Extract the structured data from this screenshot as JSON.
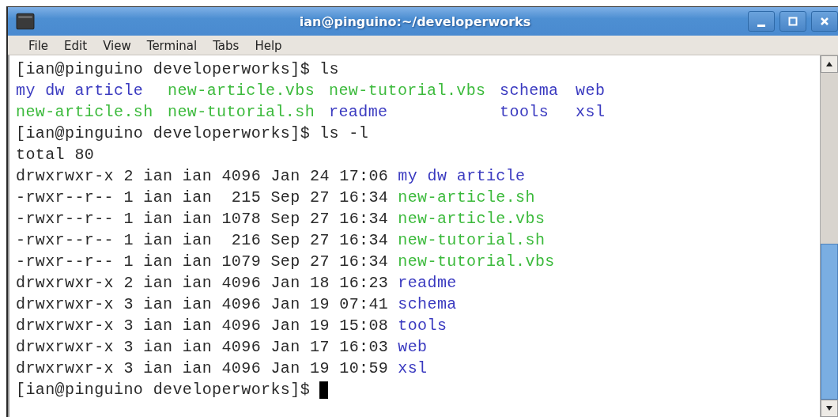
{
  "window": {
    "title": "ian@pinguino:~/developerworks"
  },
  "menu": [
    {
      "label": "File"
    },
    {
      "label": "Edit"
    },
    {
      "label": "View"
    },
    {
      "label": "Terminal"
    },
    {
      "label": "Tabs"
    },
    {
      "label": "Help"
    }
  ],
  "terminal": {
    "lines": [
      {
        "kind": "prompt",
        "prompt": "[ian@pinguino developerworks]$",
        "command": "ls"
      },
      {
        "kind": "grid",
        "items": [
          {
            "name": "my dw article",
            "kind": "dir"
          },
          {
            "name": "new-article.vbs",
            "kind": "exec"
          },
          {
            "name": "new-tutorial.vbs",
            "kind": "exec"
          },
          {
            "name": "schema",
            "kind": "dir"
          },
          {
            "name": "web",
            "kind": "dir"
          }
        ]
      },
      {
        "kind": "grid",
        "items": [
          {
            "name": "new-article.sh",
            "kind": "exec"
          },
          {
            "name": "new-tutorial.sh",
            "kind": "exec"
          },
          {
            "name": "readme",
            "kind": "dir"
          },
          {
            "name": "tools",
            "kind": "dir"
          },
          {
            "name": "xsl",
            "kind": "dir"
          }
        ]
      },
      {
        "kind": "prompt",
        "prompt": "[ian@pinguino developerworks]$",
        "command": "ls -l"
      },
      {
        "kind": "text",
        "text": "total 80"
      },
      {
        "kind": "long",
        "info": "drwxrwxr-x 2 ian ian 4096 Jan 24 17:06",
        "file": {
          "name": "my dw article",
          "kind": "dir"
        }
      },
      {
        "kind": "long",
        "info": "-rwxr--r-- 1 ian ian  215 Sep 27 16:34",
        "file": {
          "name": "new-article.sh",
          "kind": "exec"
        }
      },
      {
        "kind": "long",
        "info": "-rwxr--r-- 1 ian ian 1078 Sep 27 16:34",
        "file": {
          "name": "new-article.vbs",
          "kind": "exec"
        }
      },
      {
        "kind": "long",
        "info": "-rwxr--r-- 1 ian ian  216 Sep 27 16:34",
        "file": {
          "name": "new-tutorial.sh",
          "kind": "exec"
        }
      },
      {
        "kind": "long",
        "info": "-rwxr--r-- 1 ian ian 1079 Sep 27 16:34",
        "file": {
          "name": "new-tutorial.vbs",
          "kind": "exec"
        }
      },
      {
        "kind": "long",
        "info": "drwxrwxr-x 2 ian ian 4096 Jan 18 16:23",
        "file": {
          "name": "readme",
          "kind": "dir"
        }
      },
      {
        "kind": "long",
        "info": "drwxrwxr-x 3 ian ian 4096 Jan 19 07:41",
        "file": {
          "name": "schema",
          "kind": "dir"
        }
      },
      {
        "kind": "long",
        "info": "drwxrwxr-x 3 ian ian 4096 Jan 19 15:08",
        "file": {
          "name": "tools",
          "kind": "dir"
        }
      },
      {
        "kind": "long",
        "info": "drwxrwxr-x 3 ian ian 4096 Jan 17 16:03",
        "file": {
          "name": "web",
          "kind": "dir"
        }
      },
      {
        "kind": "long",
        "info": "drwxrwxr-x 3 ian ian 4096 Jan 19 10:59",
        "file": {
          "name": "xsl",
          "kind": "dir"
        }
      },
      {
        "kind": "prompt",
        "prompt": "[ian@pinguino developerworks]$",
        "cursor": true
      }
    ]
  }
}
